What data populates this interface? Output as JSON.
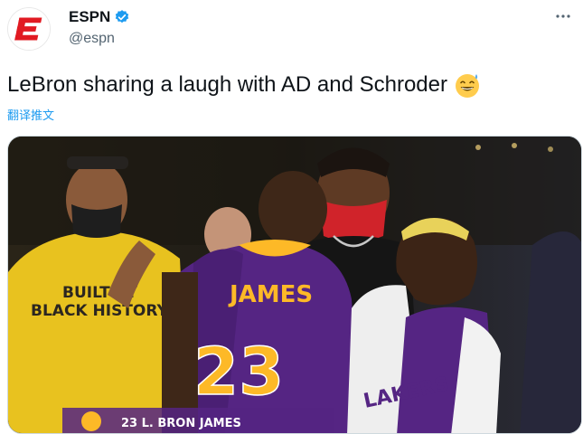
{
  "account": {
    "display_name": "ESPN",
    "handle": "@espn",
    "logo_text": "E",
    "brand_color": "#e11a22",
    "verified_color": "#1d9bf0"
  },
  "tweet": {
    "text": "LeBron sharing a laugh with AD and Schroder",
    "emoji": "grinning-face-with-sweat",
    "translate_label": "翻译推文"
  },
  "media": {
    "jersey_name": "JAMES",
    "jersey_number": "23",
    "shirt_text_line1": "BUILT BY",
    "shirt_text_line2": "BLACK HISTORY",
    "towel_text": "LAKERS",
    "lower_third": "23 L. BRON JAMES"
  },
  "icons": {
    "more": "more-icon",
    "verified": "verified-badge-icon"
  }
}
